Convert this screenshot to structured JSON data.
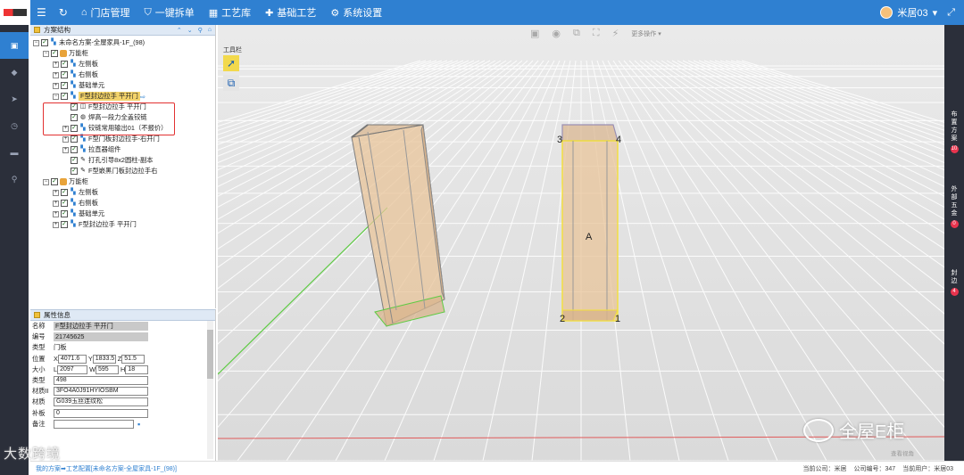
{
  "colors": {
    "nav_bg": "#2f80d1",
    "rail_bg": "#2b2f3a",
    "highlight_row": "#f3d36a",
    "redbox": "#e23131",
    "cabinet_fill": "#e8c49a"
  },
  "topbar": {
    "nav": [
      {
        "icon": "home-icon",
        "label": "门店管理"
      },
      {
        "icon": "shield-icon",
        "label": "一键拆单"
      },
      {
        "icon": "grid-icon",
        "label": "工艺库"
      },
      {
        "icon": "puzzle-icon",
        "label": "基础工艺"
      },
      {
        "icon": "gear-icon",
        "label": "系统设置"
      }
    ],
    "user": "米居03"
  },
  "tree_panel": {
    "title": "方案结构",
    "nodes": [
      {
        "label": "未命名方案-全屋家具-1F_(98)",
        "level": 0,
        "expand": "−",
        "icon": "doc"
      },
      {
        "label": "万能柜",
        "level": 1,
        "expand": "−",
        "icon": "folder"
      },
      {
        "label": "左侧板",
        "level": 2,
        "expand": "+",
        "icon": "doc"
      },
      {
        "label": "右侧板",
        "level": 2,
        "expand": "+",
        "icon": "doc"
      },
      {
        "label": "基础单元",
        "level": 2,
        "expand": "+",
        "icon": "doc"
      },
      {
        "label": "F型封边拉手 平开门",
        "level": 2,
        "expand": "−",
        "icon": "doc",
        "selected": true
      },
      {
        "label": "F型封边拉手 平开门",
        "level": 3,
        "expand": "",
        "icon": "door"
      },
      {
        "label": "焊高一段力全盖铰链",
        "level": 3,
        "expand": "",
        "icon": "hinge"
      },
      {
        "label": "铰链常用输出01（不报价）",
        "level": 3,
        "expand": "+",
        "icon": "doc"
      },
      {
        "label": "F型门板封边拉手-右开门",
        "level": 3,
        "expand": "+",
        "icon": "doc"
      },
      {
        "label": "拉直器组件",
        "level": 3,
        "expand": "+",
        "icon": "doc"
      },
      {
        "label": "打孔引导8x2圆柱-副本",
        "level": 3,
        "expand": "",
        "icon": "tool"
      },
      {
        "label": "F型嵌黑门板封边拉手右",
        "level": 3,
        "expand": "",
        "icon": "tool"
      },
      {
        "label": "万能柜",
        "level": 1,
        "expand": "−",
        "icon": "folder"
      },
      {
        "label": "左侧板",
        "level": 2,
        "expand": "+",
        "icon": "doc"
      },
      {
        "label": "右侧板",
        "level": 2,
        "expand": "+",
        "icon": "doc"
      },
      {
        "label": "基础单元",
        "level": 2,
        "expand": "+",
        "icon": "doc"
      },
      {
        "label": "F型封边拉手 平开门",
        "level": 2,
        "expand": "+",
        "icon": "doc"
      }
    ]
  },
  "props": {
    "title": "属性信息",
    "name_label": "名称",
    "name": "F型封边拉手 平开门",
    "code_label": "编号",
    "code": "21745625",
    "type_label": "类型",
    "type": "门板",
    "pos_label": "位置",
    "pos_x": "4071.6",
    "pos_y": "1833.5",
    "pos_z": "51.5",
    "size_label": "大小",
    "size_l": "2097",
    "size_w": "595",
    "size_h": "18",
    "type2_label": "类型",
    "type2": "498",
    "mat1_label": "材质II",
    "mat1": "3FO4A0J91HYIOSBM",
    "mat2_label": "材质",
    "mat2": "G039玉丝连纹松",
    "fill_label": "补板",
    "fill": "0",
    "note_label": "备注",
    "note": ""
  },
  "viewport": {
    "more_ops": "更多操作",
    "toolbox_title": "工具栏",
    "view_label": "查看视角",
    "corner_labels": [
      "1",
      "2",
      "3",
      "4"
    ],
    "center_mark": "A"
  },
  "right_rail": [
    {
      "label": "布置方案",
      "badge": "10"
    },
    {
      "label": "外部五金",
      "badge": "0"
    },
    {
      "label": "封边",
      "badge": "4"
    }
  ],
  "status": {
    "breadcrumb": "我的方案➡工艺配置[未命名方案-全屋家具-1F_(98)]",
    "company": "当前公司：米居",
    "company_no": "公司编号：347",
    "user": "当前用户：米居03"
  },
  "watermarks": {
    "left": "大数跨境",
    "right": "全屋E柜"
  }
}
